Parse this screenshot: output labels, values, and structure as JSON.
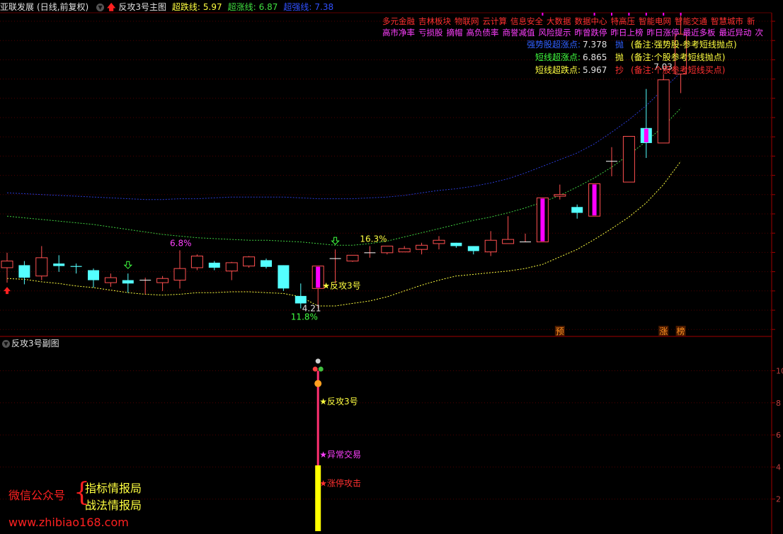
{
  "header": {
    "stock_title": "亚联发展",
    "period_info": "(日线,前复权)",
    "main_indicator": "反攻3号主图",
    "line1_label": "超跌线:",
    "line1_value": "5.97",
    "line2_label": "超涨线:",
    "line2_value": "6.87",
    "line3_label": "超强线:",
    "line3_value": "7.38"
  },
  "concepts": {
    "row1": [
      "多元金融",
      "吉林板块",
      "物联网",
      "云计算",
      "信息安全",
      "大数据",
      "数据中心",
      "特高压",
      "智能电网",
      "智能交通",
      "智慧城市",
      "新"
    ],
    "row2": [
      "高市净率",
      "亏损股",
      "摘帽",
      "高负债率",
      "商誉减值",
      "风险提示",
      "昨曾跌停",
      "昨日上榜",
      "昨日涨停",
      "最近多板",
      "最近异动",
      "次"
    ]
  },
  "legend": [
    {
      "label": "强势股超涨点:",
      "value": "7.378",
      "action": "抛",
      "note": "(备注:强势股-参考短线抛点)",
      "color": "#3060ff"
    },
    {
      "label": "短线超涨点:",
      "value": "6.865",
      "action": "抛",
      "note": "(备注:个股参考短线抛点)",
      "color": "#40ff40"
    },
    {
      "label": "短线超跌点:",
      "value": "5.967",
      "action": "抄",
      "note": "(备注:个股参考短线买点)",
      "color": "#ffff40"
    }
  ],
  "sub_panel": {
    "title": "反攻3号副图"
  },
  "watermark": {
    "prefix": "微信公众号",
    "line1": "指标情报局",
    "line2": "战法情报局",
    "url": "www.zhibiao168.com"
  },
  "colors": {
    "up": "#ff5050",
    "down": "#54ffff",
    "magenta": "#ff00ff",
    "blue_line": "#2a3ad0",
    "green_line": "#40d040",
    "yellow_line": "#ffff40",
    "axis": "#a00000"
  },
  "chart_data": {
    "type": "candlestick",
    "ylim": [
      3.95,
      7.75
    ],
    "sub_ylim": [
      0,
      11.3
    ],
    "right_axis_sub_ticks": [
      "10",
      "8",
      "6",
      "4",
      "2"
    ],
    "candles": [
      {
        "o": 4.7,
        "h": 4.88,
        "l": 4.52,
        "c": 4.78
      },
      {
        "o": 4.73,
        "h": 4.78,
        "l": 4.5,
        "c": 4.58
      },
      {
        "o": 4.6,
        "h": 4.96,
        "l": 4.55,
        "c": 4.82
      },
      {
        "o": 4.75,
        "h": 4.85,
        "l": 4.65,
        "c": 4.72
      },
      {
        "o": 4.72,
        "h": 4.75,
        "l": 4.63,
        "c": 4.71
      },
      {
        "o": 4.67,
        "h": 4.69,
        "l": 4.46,
        "c": 4.55
      },
      {
        "o": 4.52,
        "h": 4.63,
        "l": 4.47,
        "c": 4.58
      },
      {
        "o": 4.55,
        "h": 4.63,
        "l": 4.4,
        "c": 4.51
      },
      {
        "o": 4.55,
        "h": 4.58,
        "l": 4.38,
        "c": 4.55
      },
      {
        "o": 4.52,
        "h": 4.6,
        "l": 4.42,
        "c": 4.57
      },
      {
        "o": 4.55,
        "h": 4.91,
        "l": 4.45,
        "c": 4.69
      },
      {
        "o": 4.7,
        "h": 4.86,
        "l": 4.67,
        "c": 4.84
      },
      {
        "o": 4.76,
        "h": 4.78,
        "l": 4.67,
        "c": 4.7
      },
      {
        "o": 4.66,
        "h": 4.77,
        "l": 4.55,
        "c": 4.76
      },
      {
        "o": 4.72,
        "h": 4.84,
        "l": 4.7,
        "c": 4.83
      },
      {
        "o": 4.79,
        "h": 4.81,
        "l": 4.69,
        "c": 4.71
      },
      {
        "o": 4.73,
        "h": 4.73,
        "l": 4.42,
        "c": 4.45
      },
      {
        "o": 4.36,
        "h": 4.51,
        "l": 4.21,
        "c": 4.27
      },
      {
        "o": 4.45,
        "h": 4.72,
        "l": 4.21,
        "c": 4.72
      },
      {
        "o": 4.81,
        "h": 4.92,
        "l": 4.51,
        "c": 4.81
      },
      {
        "o": 4.78,
        "h": 4.85,
        "l": 4.77,
        "c": 4.85
      },
      {
        "o": 4.88,
        "h": 4.96,
        "l": 4.82,
        "c": 4.88
      },
      {
        "o": 4.88,
        "h": 4.93,
        "l": 4.86,
        "c": 4.96
      },
      {
        "o": 4.89,
        "h": 4.96,
        "l": 4.89,
        "c": 4.93
      },
      {
        "o": 4.92,
        "h": 5.0,
        "l": 4.86,
        "c": 4.97
      },
      {
        "o": 4.99,
        "h": 5.08,
        "l": 4.92,
        "c": 5.03
      },
      {
        "o": 5.0,
        "h": 5.0,
        "l": 4.94,
        "c": 4.96
      },
      {
        "o": 4.96,
        "h": 4.96,
        "l": 4.86,
        "c": 4.9
      },
      {
        "o": 4.89,
        "h": 5.14,
        "l": 4.84,
        "c": 5.03
      },
      {
        "o": 4.99,
        "h": 5.32,
        "l": 4.99,
        "c": 5.04
      },
      {
        "o": 5.01,
        "h": 5.11,
        "l": 5.01,
        "c": 5.01
      },
      {
        "o": 5.01,
        "h": 5.54,
        "l": 5.01,
        "c": 5.54
      },
      {
        "o": 5.56,
        "h": 5.7,
        "l": 5.52,
        "c": 5.58
      },
      {
        "o": 5.43,
        "h": 5.46,
        "l": 5.29,
        "c": 5.36
      },
      {
        "o": 5.32,
        "h": 5.71,
        "l": 5.32,
        "c": 5.71
      },
      {
        "o": 5.98,
        "h": 6.15,
        "l": 5.8,
        "c": 5.98
      },
      {
        "o": 5.73,
        "h": 6.28,
        "l": 5.73,
        "c": 6.28
      },
      {
        "o": 6.38,
        "h": 6.85,
        "l": 6.02,
        "c": 6.2
      },
      {
        "o": 6.2,
        "h": 7.03,
        "l": 6.2,
        "c": 6.96
      },
      {
        "o": 7.03,
        "h": 7.73,
        "l": 6.8,
        "c": 7.51
      }
    ],
    "magenta_bars": [
      18,
      31,
      34,
      37
    ],
    "curves": {
      "upper_blue": [
        5.6,
        5.59,
        5.58,
        5.57,
        5.56,
        5.55,
        5.54,
        5.53,
        5.52,
        5.52,
        5.53,
        5.53,
        5.54,
        5.55,
        5.55,
        5.55,
        5.55,
        5.54,
        5.53,
        5.53,
        5.53,
        5.54,
        5.55,
        5.57,
        5.6,
        5.63,
        5.65,
        5.68,
        5.72,
        5.77,
        5.84,
        5.92,
        6.0,
        6.08,
        6.19,
        6.33,
        6.48,
        6.65,
        6.85,
        7.05
      ],
      "middle_green": [
        5.32,
        5.3,
        5.28,
        5.26,
        5.24,
        5.22,
        5.19,
        5.16,
        5.13,
        5.1,
        5.08,
        5.06,
        5.05,
        5.04,
        5.03,
        5.03,
        5.02,
        5.01,
        4.99,
        4.97,
        4.97,
        4.99,
        5.02,
        5.07,
        5.12,
        5.17,
        5.22,
        5.27,
        5.31,
        5.36,
        5.42,
        5.49,
        5.57,
        5.67,
        5.78,
        5.91,
        6.06,
        6.22,
        6.4,
        6.62
      ],
      "lower_yellow": [
        4.57,
        4.56,
        4.53,
        4.51,
        4.48,
        4.46,
        4.43,
        4.4,
        4.38,
        4.37,
        4.38,
        4.4,
        4.4,
        4.41,
        4.41,
        4.4,
        4.39,
        4.35,
        4.24,
        4.24,
        4.27,
        4.3,
        4.35,
        4.42,
        4.49,
        4.55,
        4.6,
        4.62,
        4.64,
        4.66,
        4.69,
        4.74,
        4.83,
        4.92,
        5.04,
        5.17,
        5.31,
        5.48,
        5.7,
        5.98
      ]
    },
    "annotations": [
      {
        "i": 10,
        "text": "6.8%",
        "color": "#ff40ff"
      },
      {
        "i": 21,
        "text": "16.3%",
        "color": "#ffff40"
      },
      {
        "i": 38,
        "text": "7.03",
        "color": "#e0e0e0"
      },
      {
        "i": 17,
        "text": "4.21",
        "color": "#e0e0e0"
      },
      {
        "i": 17,
        "text": "11.8%",
        "color": "#40ff40"
      }
    ],
    "signals": {
      "main_label": "★反攻3号",
      "sub_labels": [
        {
          "text": "★反攻3号",
          "color": "#ffff40"
        },
        {
          "text": "★异常交易",
          "color": "#ff40ff"
        },
        {
          "text": "★涨停攻击",
          "color": "#ff3030"
        }
      ],
      "tags": [
        {
          "i": 32,
          "text": "预"
        },
        {
          "i": 38,
          "text": "涨"
        },
        {
          "i": 39,
          "text": "榜"
        }
      ]
    },
    "sub_bars": [
      {
        "i": 18,
        "from": 4.0,
        "to": 10.0,
        "color": "#ff3070",
        "kind": "line"
      },
      {
        "i": 18,
        "from": 0,
        "to": 4.1,
        "color": "#ffff00",
        "kind": "bar"
      }
    ]
  }
}
